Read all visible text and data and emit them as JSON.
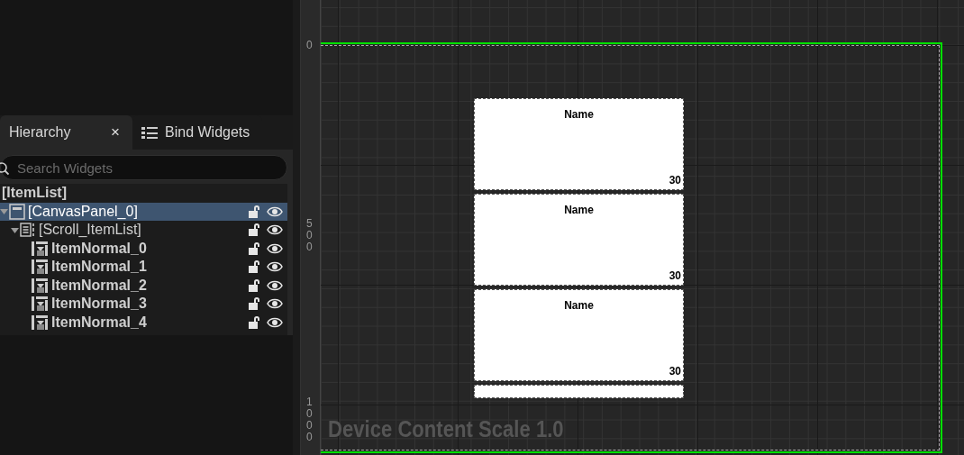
{
  "tabs": [
    {
      "label": "Hierarchy",
      "selected": true,
      "close": "×"
    },
    {
      "label": "Bind Widgets",
      "selected": false
    }
  ],
  "search": {
    "placeholder": "Search Widgets"
  },
  "tree": {
    "label": "[ItemList]",
    "children": [
      {
        "label": "[CanvasPanel_0]",
        "kind": "canvas",
        "selected": true,
        "expanded": true,
        "children": [
          {
            "label": "[Scroll_ItemList]",
            "kind": "scroll",
            "selected": false,
            "expanded": true,
            "children": [
              {
                "label": "ItemNormal_0",
                "kind": "widget",
                "selected": false
              },
              {
                "label": "ItemNormal_1",
                "kind": "widget",
                "selected": false
              },
              {
                "label": "ItemNormal_2",
                "kind": "widget",
                "selected": false
              },
              {
                "label": "ItemNormal_3",
                "kind": "widget",
                "selected": false
              },
              {
                "label": "ItemNormal_4",
                "kind": "widget",
                "selected": false
              }
            ]
          }
        ]
      }
    ]
  },
  "ruler": {
    "labels": [
      "0",
      "500",
      "1000"
    ]
  },
  "cards": [
    {
      "kind": "full",
      "title": "Name",
      "value": "30"
    },
    {
      "kind": "full",
      "title": "Name",
      "value": "30"
    },
    {
      "kind": "full",
      "title": "Name",
      "value": "30"
    },
    {
      "kind": "clipped"
    }
  ],
  "overlay": "Device Content Scale 1.0"
}
